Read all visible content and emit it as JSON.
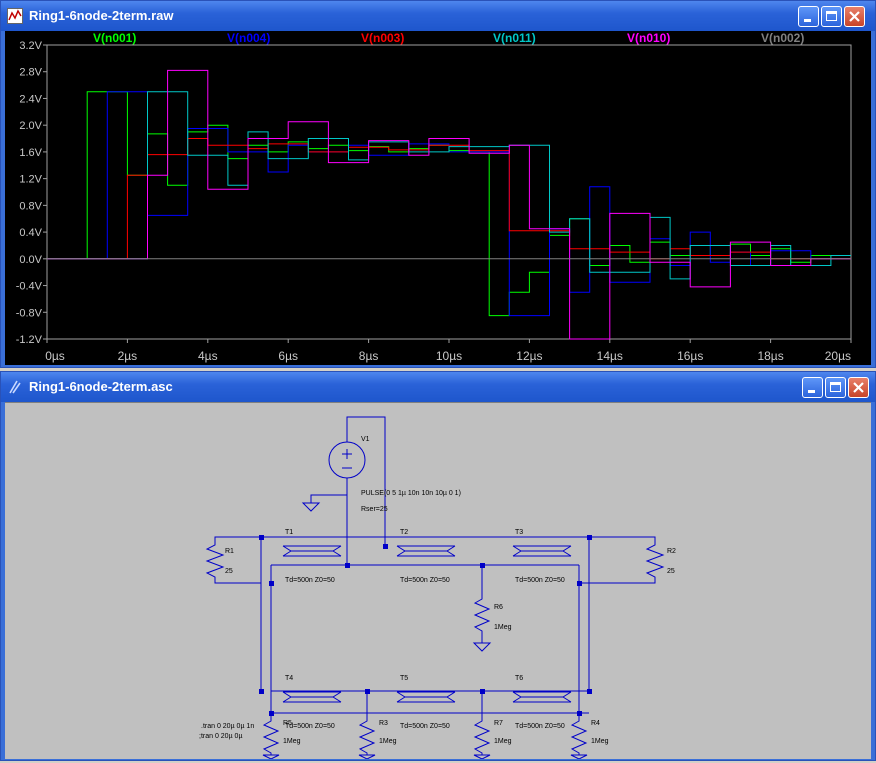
{
  "waveform_window": {
    "title": "Ring1-6node-2term.raw",
    "traces": [
      {
        "name": "V(n001)",
        "color": "#00ff00"
      },
      {
        "name": "V(n004)",
        "color": "#0000ff"
      },
      {
        "name": "V(n003)",
        "color": "#ff0000"
      },
      {
        "name": "V(n011)",
        "color": "#00c8c8"
      },
      {
        "name": "V(n010)",
        "color": "#ff00ff"
      },
      {
        "name": "V(n002)",
        "color": "#808080"
      }
    ]
  },
  "schematic_window": {
    "title": "Ring1-6node-2term.asc",
    "source": {
      "ref": "V1",
      "value": "PULSE(0 5 1µ 10n 10n 10µ 0 1)",
      "rser": "Rser=25"
    },
    "tlines": [
      {
        "ref": "T1",
        "params": "Td=500n Z0=50"
      },
      {
        "ref": "T2",
        "params": "Td=500n Z0=50"
      },
      {
        "ref": "T3",
        "params": "Td=500n Z0=50"
      },
      {
        "ref": "T4",
        "params": "Td=500n Z0=50"
      },
      {
        "ref": "T5",
        "params": "Td=500n Z0=50"
      },
      {
        "ref": "T6",
        "params": "Td=500n Z0=50"
      }
    ],
    "resistors": [
      {
        "ref": "R1",
        "value": "25"
      },
      {
        "ref": "R2",
        "value": "25"
      },
      {
        "ref": "R3",
        "value": "1Meg"
      },
      {
        "ref": "R4",
        "value": "1Meg"
      },
      {
        "ref": "R5",
        "value": "1Meg"
      },
      {
        "ref": "R6",
        "value": "1Meg"
      },
      {
        "ref": "R7",
        "value": "1Meg"
      }
    ],
    "directives": [
      ".tran 0 20µ 0µ 1n",
      ";tran 0 20µ 0µ"
    ]
  },
  "chart_data": {
    "type": "line",
    "title": "",
    "xlabel": "",
    "ylabel": "",
    "xlim": [
      0,
      20
    ],
    "ylim": [
      -1.2,
      3.2
    ],
    "x_tick_labels": [
      "0µs",
      "2µs",
      "4µs",
      "6µs",
      "8µs",
      "10µs",
      "12µs",
      "14µs",
      "16µs",
      "18µs",
      "20µs"
    ],
    "y_tick_labels": [
      "3.2V",
      "2.8V",
      "2.4V",
      "2.0V",
      "1.6V",
      "1.2V",
      "0.8V",
      "0.4V",
      "0.0V",
      "-0.4V",
      "-0.8V",
      "-1.2V"
    ],
    "grid": false,
    "legend": "top",
    "series": [
      {
        "name": "V(n001)",
        "color": "#00ff00",
        "points": [
          [
            0,
            0
          ],
          [
            1,
            0
          ],
          [
            1,
            2.5
          ],
          [
            2,
            2.5
          ],
          [
            2,
            1.25
          ],
          [
            2.5,
            1.25
          ],
          [
            2.5,
            1.87
          ],
          [
            3,
            1.87
          ],
          [
            3,
            1.1
          ],
          [
            3.5,
            1.1
          ],
          [
            3.5,
            1.9
          ],
          [
            4,
            1.9
          ],
          [
            4,
            2.0
          ],
          [
            4.5,
            2.0
          ],
          [
            4.5,
            1.5
          ],
          [
            5,
            1.5
          ],
          [
            5,
            1.7
          ],
          [
            5.5,
            1.7
          ],
          [
            5.5,
            1.6
          ],
          [
            6,
            1.6
          ],
          [
            6,
            1.75
          ],
          [
            6.5,
            1.75
          ],
          [
            6.5,
            1.65
          ],
          [
            7,
            1.65
          ],
          [
            7,
            1.7
          ],
          [
            7.5,
            1.7
          ],
          [
            7.5,
            1.62
          ],
          [
            8,
            1.62
          ],
          [
            8,
            1.68
          ],
          [
            8.5,
            1.68
          ],
          [
            8.5,
            1.6
          ],
          [
            9,
            1.6
          ],
          [
            9,
            1.65
          ],
          [
            9.5,
            1.65
          ],
          [
            9.5,
            1.7
          ],
          [
            10,
            1.7
          ],
          [
            10,
            1.62
          ],
          [
            10.5,
            1.62
          ],
          [
            10.5,
            1.6
          ],
          [
            11,
            1.6
          ],
          [
            11,
            -0.85
          ],
          [
            11.5,
            -0.85
          ],
          [
            11.5,
            -0.5
          ],
          [
            12,
            -0.5
          ],
          [
            12,
            -0.2
          ],
          [
            12.5,
            -0.2
          ],
          [
            12.5,
            0.35
          ],
          [
            13,
            0.35
          ],
          [
            13,
            0.6
          ],
          [
            13.5,
            0.6
          ],
          [
            13.5,
            -0.1
          ],
          [
            14,
            -0.1
          ],
          [
            14,
            0.2
          ],
          [
            14.5,
            0.2
          ],
          [
            14.5,
            -0.05
          ],
          [
            15,
            -0.05
          ],
          [
            15,
            0.25
          ],
          [
            15.5,
            0.25
          ],
          [
            15.5,
            0.05
          ],
          [
            16,
            0.05
          ],
          [
            16,
            0.2
          ],
          [
            16.5,
            0.2
          ],
          [
            16.5,
            0.05
          ],
          [
            17,
            0.05
          ],
          [
            17,
            0.22
          ],
          [
            17.5,
            0.22
          ],
          [
            17.5,
            0.05
          ],
          [
            18,
            0.05
          ],
          [
            18,
            0.15
          ],
          [
            18.5,
            0.15
          ],
          [
            18.5,
            -0.05
          ],
          [
            19,
            -0.05
          ],
          [
            19,
            0.05
          ],
          [
            20,
            0.05
          ]
        ]
      },
      {
        "name": "V(n004)",
        "color": "#0000ff",
        "points": [
          [
            0,
            0
          ],
          [
            1.5,
            0
          ],
          [
            1.5,
            2.5
          ],
          [
            2.5,
            2.5
          ],
          [
            2.5,
            0.65
          ],
          [
            3.5,
            0.65
          ],
          [
            3.5,
            1.95
          ],
          [
            4.5,
            1.95
          ],
          [
            4.5,
            1.6
          ],
          [
            5.5,
            1.6
          ],
          [
            5.5,
            1.3
          ],
          [
            6,
            1.3
          ],
          [
            6,
            1.7
          ],
          [
            6.5,
            1.7
          ],
          [
            6.5,
            1.6
          ],
          [
            7.5,
            1.6
          ],
          [
            7.5,
            1.7
          ],
          [
            8,
            1.7
          ],
          [
            8,
            1.55
          ],
          [
            9,
            1.55
          ],
          [
            9,
            1.72
          ],
          [
            10,
            1.72
          ],
          [
            10,
            1.6
          ],
          [
            11.5,
            1.6
          ],
          [
            11.5,
            -0.85
          ],
          [
            12.5,
            -0.85
          ],
          [
            12.5,
            0.45
          ],
          [
            13,
            0.45
          ],
          [
            13,
            -0.5
          ],
          [
            13.5,
            -0.5
          ],
          [
            13.5,
            1.08
          ],
          [
            14,
            1.08
          ],
          [
            14,
            -0.35
          ],
          [
            15,
            -0.35
          ],
          [
            15,
            0.3
          ],
          [
            15.5,
            0.3
          ],
          [
            15.5,
            -0.1
          ],
          [
            16,
            -0.1
          ],
          [
            16,
            0.4
          ],
          [
            16.5,
            0.4
          ],
          [
            16.5,
            -0.05
          ],
          [
            17,
            -0.05
          ],
          [
            17,
            0.1
          ],
          [
            17.5,
            0.1
          ],
          [
            17.5,
            -0.1
          ],
          [
            18,
            -0.1
          ],
          [
            18,
            0.12
          ],
          [
            19,
            0.12
          ],
          [
            19,
            0.0
          ],
          [
            20,
            0.0
          ]
        ]
      },
      {
        "name": "V(n003)",
        "color": "#ff0000",
        "points": [
          [
            0,
            0
          ],
          [
            2,
            0
          ],
          [
            2,
            1.25
          ],
          [
            2.5,
            1.25
          ],
          [
            2.5,
            1.56
          ],
          [
            3.5,
            1.56
          ],
          [
            3.5,
            1.8
          ],
          [
            4,
            1.8
          ],
          [
            4,
            1.7
          ],
          [
            5,
            1.7
          ],
          [
            5,
            1.65
          ],
          [
            5.5,
            1.65
          ],
          [
            5.5,
            1.72
          ],
          [
            6.5,
            1.72
          ],
          [
            6.5,
            1.6
          ],
          [
            7.5,
            1.6
          ],
          [
            7.5,
            1.67
          ],
          [
            8.5,
            1.67
          ],
          [
            8.5,
            1.63
          ],
          [
            9.5,
            1.63
          ],
          [
            9.5,
            1.7
          ],
          [
            10.5,
            1.7
          ],
          [
            10.5,
            1.62
          ],
          [
            11.5,
            1.62
          ],
          [
            11.5,
            0.42
          ],
          [
            12.5,
            0.42
          ],
          [
            12.5,
            0.42
          ],
          [
            13,
            0.42
          ],
          [
            13,
            0.15
          ],
          [
            14,
            0.15
          ],
          [
            14,
            0.1
          ],
          [
            15,
            0.1
          ],
          [
            15,
            0.0
          ],
          [
            15.5,
            0.0
          ],
          [
            15.5,
            0.15
          ],
          [
            16,
            0.15
          ],
          [
            16,
            0.05
          ],
          [
            17,
            0.05
          ],
          [
            17,
            0.1
          ],
          [
            18,
            0.1
          ],
          [
            18,
            0.0
          ],
          [
            20,
            0.0
          ]
        ]
      },
      {
        "name": "V(n011)",
        "color": "#00c8c8",
        "points": [
          [
            0,
            0
          ],
          [
            2.5,
            0
          ],
          [
            2.5,
            2.5
          ],
          [
            3.5,
            2.5
          ],
          [
            3.5,
            1.55
          ],
          [
            4.5,
            1.55
          ],
          [
            4.5,
            1.1
          ],
          [
            5,
            1.1
          ],
          [
            5,
            1.9
          ],
          [
            5.5,
            1.9
          ],
          [
            5.5,
            1.5
          ],
          [
            6.5,
            1.5
          ],
          [
            6.5,
            1.8
          ],
          [
            7.5,
            1.8
          ],
          [
            7.5,
            1.48
          ],
          [
            8,
            1.48
          ],
          [
            8,
            1.75
          ],
          [
            9,
            1.75
          ],
          [
            9,
            1.6
          ],
          [
            10,
            1.6
          ],
          [
            10,
            1.68
          ],
          [
            11.5,
            1.68
          ],
          [
            11.5,
            1.7
          ],
          [
            12.5,
            1.7
          ],
          [
            12.5,
            0.4
          ],
          [
            13,
            0.4
          ],
          [
            13,
            0.6
          ],
          [
            13.5,
            0.6
          ],
          [
            13.5,
            -0.2
          ],
          [
            15,
            -0.2
          ],
          [
            15,
            0.62
          ],
          [
            15.5,
            0.62
          ],
          [
            15.5,
            -0.3
          ],
          [
            16,
            -0.3
          ],
          [
            16,
            0.2
          ],
          [
            17,
            0.2
          ],
          [
            17,
            -0.1
          ],
          [
            18,
            -0.1
          ],
          [
            18,
            0.2
          ],
          [
            18.5,
            0.2
          ],
          [
            18.5,
            -0.1
          ],
          [
            19.5,
            -0.1
          ],
          [
            19.5,
            0.05
          ],
          [
            20,
            0.05
          ]
        ]
      },
      {
        "name": "V(n010)",
        "color": "#ff00ff",
        "points": [
          [
            0,
            0
          ],
          [
            2,
            0
          ],
          [
            2,
            0.0
          ],
          [
            2.5,
            0.0
          ],
          [
            2.5,
            1.25
          ],
          [
            3,
            1.25
          ],
          [
            3,
            2.82
          ],
          [
            4,
            2.82
          ],
          [
            4,
            1.04
          ],
          [
            5,
            1.04
          ],
          [
            5,
            1.8
          ],
          [
            6,
            1.8
          ],
          [
            6,
            2.05
          ],
          [
            7,
            2.05
          ],
          [
            7,
            1.44
          ],
          [
            8,
            1.44
          ],
          [
            8,
            1.77
          ],
          [
            9,
            1.77
          ],
          [
            9,
            1.55
          ],
          [
            9.5,
            1.55
          ],
          [
            9.5,
            1.8
          ],
          [
            10.5,
            1.8
          ],
          [
            10.5,
            1.58
          ],
          [
            11.5,
            1.58
          ],
          [
            11.5,
            1.7
          ],
          [
            12,
            1.7
          ],
          [
            12,
            0.45
          ],
          [
            13,
            0.45
          ],
          [
            13,
            -1.2
          ],
          [
            14,
            -1.2
          ],
          [
            14,
            0.68
          ],
          [
            15,
            0.68
          ],
          [
            15,
            -0.05
          ],
          [
            16,
            -0.05
          ],
          [
            16,
            -0.42
          ],
          [
            17,
            -0.42
          ],
          [
            17,
            0.25
          ],
          [
            18,
            0.25
          ],
          [
            18,
            -0.1
          ],
          [
            19,
            -0.1
          ],
          [
            19,
            0.0
          ],
          [
            20,
            0.0
          ]
        ]
      },
      {
        "name": "V(n002)",
        "color": "#808080",
        "points": [
          [
            0,
            0
          ],
          [
            20,
            0
          ]
        ]
      }
    ]
  }
}
